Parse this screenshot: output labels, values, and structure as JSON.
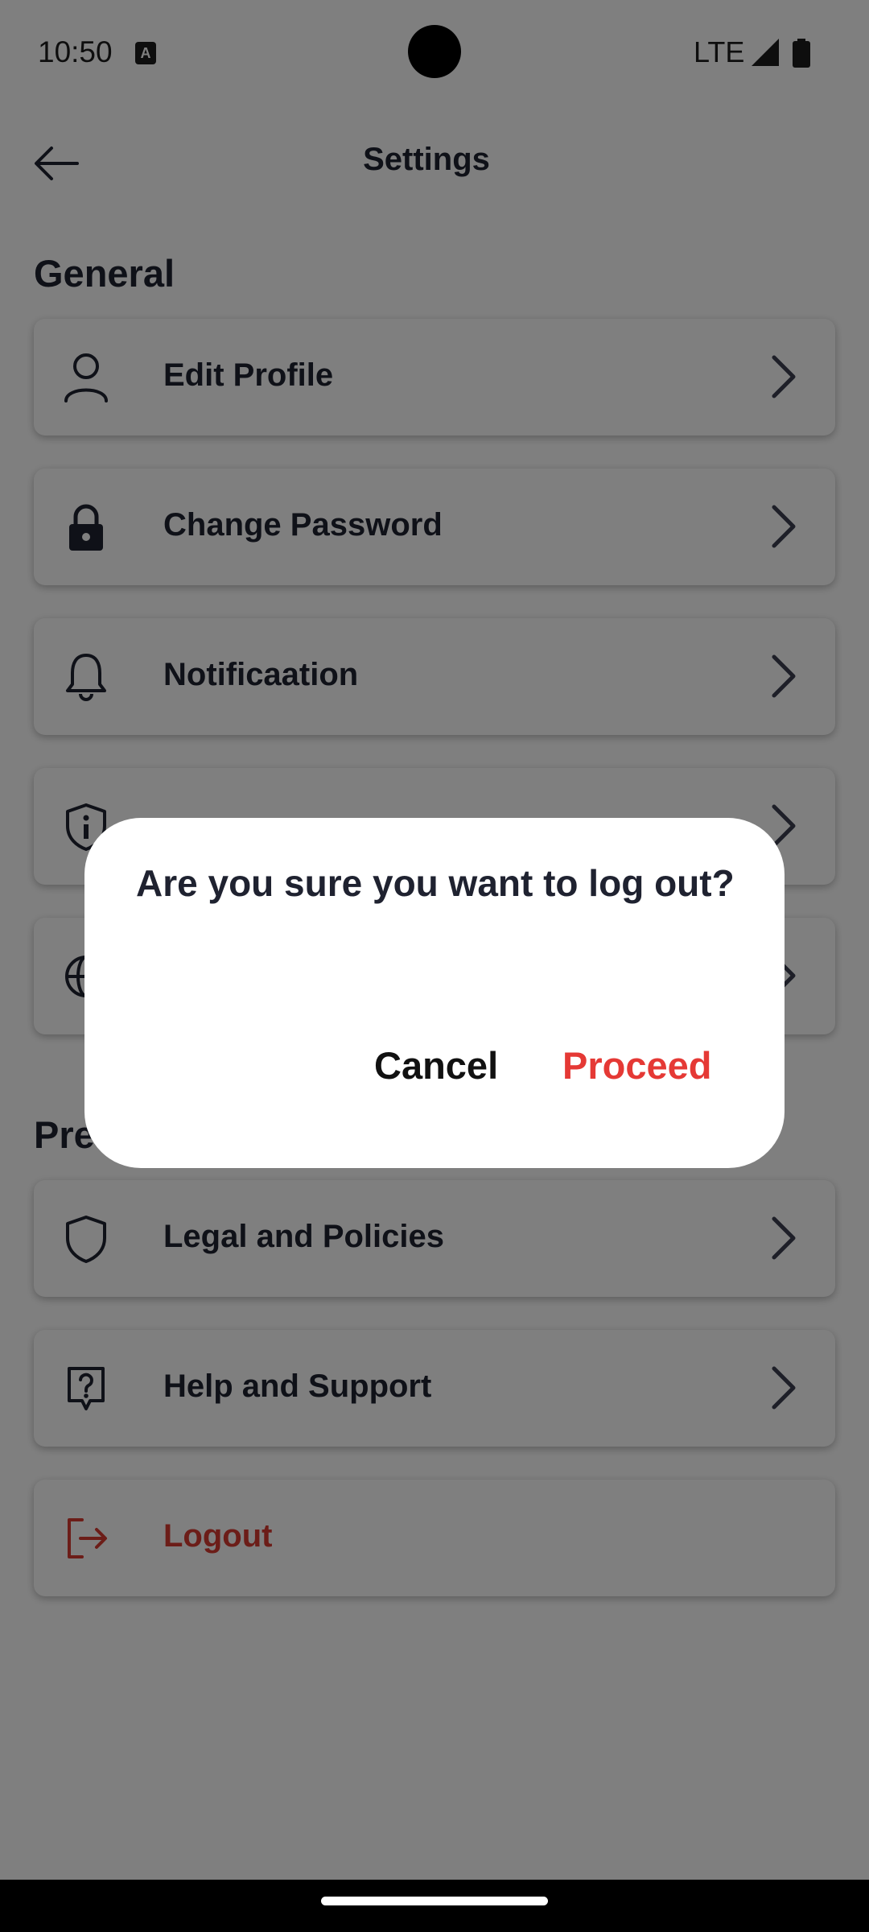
{
  "status_bar": {
    "time": "10:50",
    "a_icon_letter": "A",
    "network": "LTE"
  },
  "header": {
    "title": "Settings"
  },
  "sections": {
    "general": "General",
    "preferences_partial": "Pre"
  },
  "items": [
    {
      "label": "Edit Profile",
      "icon": "user-icon"
    },
    {
      "label": "Change Password",
      "icon": "lock-icon"
    },
    {
      "label": "Notificaation",
      "icon": "bell-icon"
    },
    {
      "label": "",
      "icon": "shield-info-icon"
    },
    {
      "label": "",
      "icon": "globe-icon"
    },
    {
      "label": "Legal and Policies",
      "icon": "shield-icon"
    },
    {
      "label": "Help and Support",
      "icon": "help-icon"
    },
    {
      "label": "Logout",
      "icon": "logout-icon"
    }
  ],
  "dialog": {
    "message": "Are you sure you want to log out?",
    "cancel": "Cancel",
    "proceed": "Proceed"
  },
  "colors": {
    "accent_red": "#e53935",
    "logout_red": "#d93a30",
    "text_dark": "#1f2230"
  }
}
